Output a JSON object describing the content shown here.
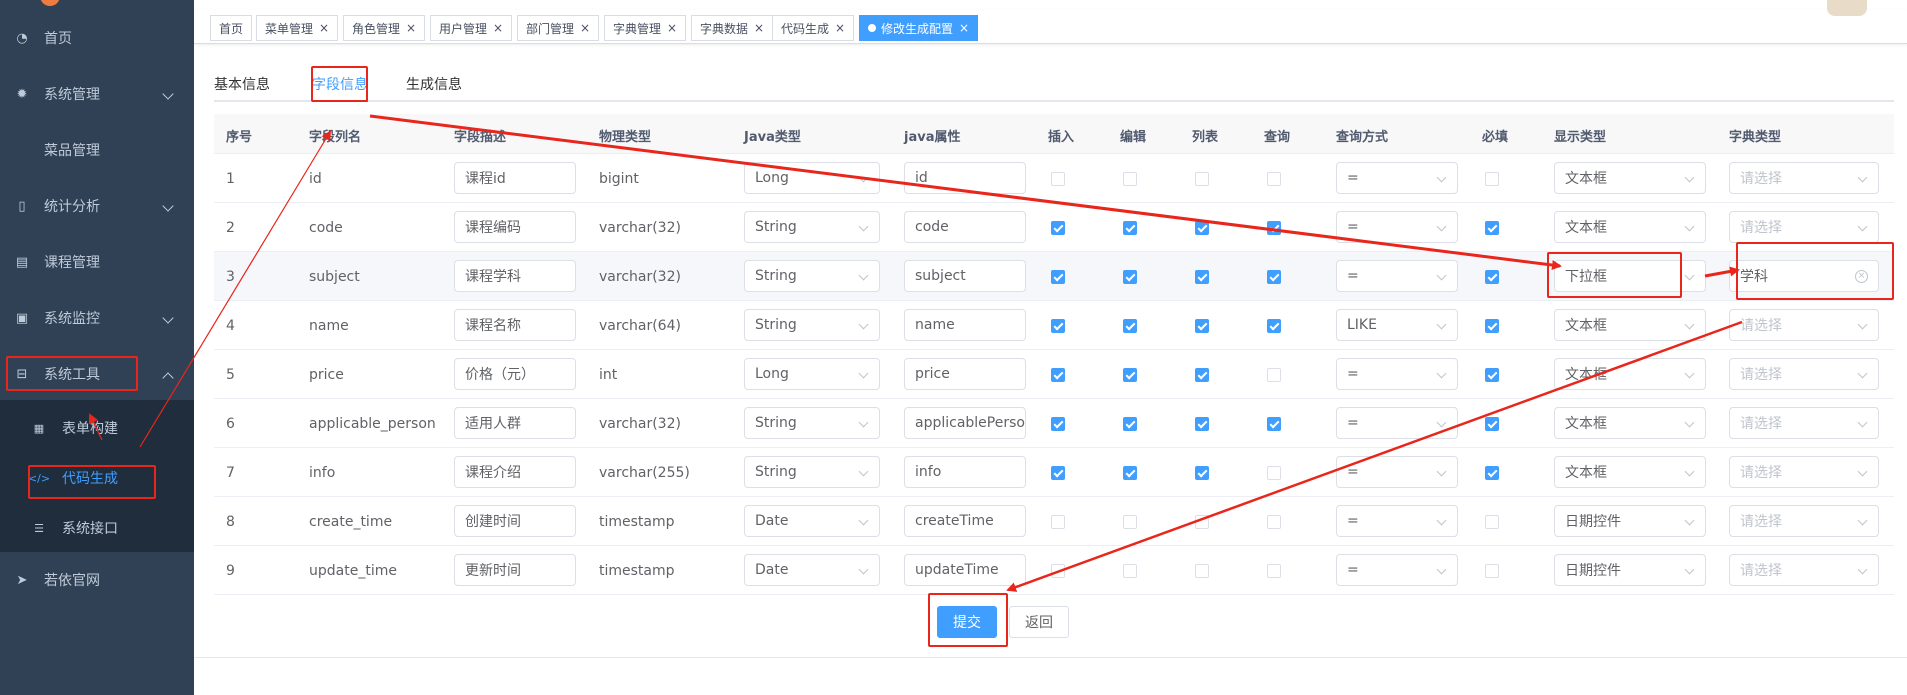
{
  "sidebar": {
    "items": [
      {
        "label": "首页",
        "icon": "dashboard-icon"
      },
      {
        "label": "系统管理",
        "icon": "gear-icon"
      },
      {
        "label": "菜品管理",
        "icon": ""
      },
      {
        "label": "统计分析",
        "icon": "phone-icon"
      },
      {
        "label": "课程管理",
        "icon": "document-icon"
      },
      {
        "label": "系统监控",
        "icon": "monitor-icon"
      },
      {
        "label": "系统工具",
        "icon": "toolbox-icon"
      },
      {
        "label": "若依官网",
        "icon": "paper-plane-icon"
      }
    ],
    "subitems": [
      {
        "label": "表单构建",
        "icon": "grid-icon"
      },
      {
        "label": "代码生成",
        "icon": "code-icon"
      },
      {
        "label": "系统接口",
        "icon": "sliders-icon"
      }
    ]
  },
  "tags": [
    "首页",
    "菜单管理",
    "角色管理",
    "用户管理",
    "部门管理",
    "字典管理",
    "字典数据",
    "代码生成",
    "修改生成配置"
  ],
  "tabs": [
    "基本信息",
    "字段信息",
    "生成信息"
  ],
  "table": {
    "headers": [
      "序号",
      "字段列名",
      "字段描述",
      "物理类型",
      "Java类型",
      "java属性",
      "插入",
      "编辑",
      "列表",
      "查询",
      "查询方式",
      "必填",
      "显示类型",
      "字典类型"
    ],
    "dict_placeholder": "请选择",
    "rows": [
      {
        "no": "1",
        "column": "id",
        "desc": "课程id",
        "phys": "bigint",
        "javaType": "Long",
        "javaField": "id",
        "insert": false,
        "edit": false,
        "list": false,
        "query": false,
        "queryType": "=",
        "required": false,
        "htmlType": "文本框",
        "dict": ""
      },
      {
        "no": "2",
        "column": "code",
        "desc": "课程编码",
        "phys": "varchar(32)",
        "javaType": "String",
        "javaField": "code",
        "insert": true,
        "edit": true,
        "list": true,
        "query": true,
        "queryType": "=",
        "required": true,
        "htmlType": "文本框",
        "dict": ""
      },
      {
        "no": "3",
        "column": "subject",
        "desc": "课程学科",
        "phys": "varchar(32)",
        "javaType": "String",
        "javaField": "subject",
        "insert": true,
        "edit": true,
        "list": true,
        "query": true,
        "queryType": "=",
        "required": true,
        "htmlType": "下拉框",
        "dict": "学科"
      },
      {
        "no": "4",
        "column": "name",
        "desc": "课程名称",
        "phys": "varchar(64)",
        "javaType": "String",
        "javaField": "name",
        "insert": true,
        "edit": true,
        "list": true,
        "query": true,
        "queryType": "LIKE",
        "required": true,
        "htmlType": "文本框",
        "dict": ""
      },
      {
        "no": "5",
        "column": "price",
        "desc": "价格（元）",
        "phys": "int",
        "javaType": "Long",
        "javaField": "price",
        "insert": true,
        "edit": true,
        "list": true,
        "query": false,
        "queryType": "=",
        "required": true,
        "htmlType": "文本框",
        "dict": ""
      },
      {
        "no": "6",
        "column": "applicable_person",
        "desc": "适用人群",
        "phys": "varchar(32)",
        "javaType": "String",
        "javaField": "applicablePerso",
        "insert": true,
        "edit": true,
        "list": true,
        "query": true,
        "queryType": "=",
        "required": true,
        "htmlType": "文本框",
        "dict": ""
      },
      {
        "no": "7",
        "column": "info",
        "desc": "课程介绍",
        "phys": "varchar(255)",
        "javaType": "String",
        "javaField": "info",
        "insert": true,
        "edit": true,
        "list": true,
        "query": false,
        "queryType": "=",
        "required": true,
        "htmlType": "文本框",
        "dict": ""
      },
      {
        "no": "8",
        "column": "create_time",
        "desc": "创建时间",
        "phys": "timestamp",
        "javaType": "Date",
        "javaField": "createTime",
        "insert": false,
        "edit": false,
        "list": false,
        "query": false,
        "queryType": "=",
        "required": false,
        "htmlType": "日期控件",
        "dict": ""
      },
      {
        "no": "9",
        "column": "update_time",
        "desc": "更新时间",
        "phys": "timestamp",
        "javaType": "Date",
        "javaField": "updateTime",
        "insert": false,
        "edit": false,
        "list": false,
        "query": false,
        "queryType": "=",
        "required": false,
        "htmlType": "日期控件",
        "dict": ""
      }
    ]
  },
  "buttons": {
    "submit": "提交",
    "back": "返回"
  },
  "colors": {
    "sidebar_bg": "#304156",
    "submenu_bg": "#1f2d3d",
    "accent": "#409eff",
    "annotation": "#e8261c"
  }
}
